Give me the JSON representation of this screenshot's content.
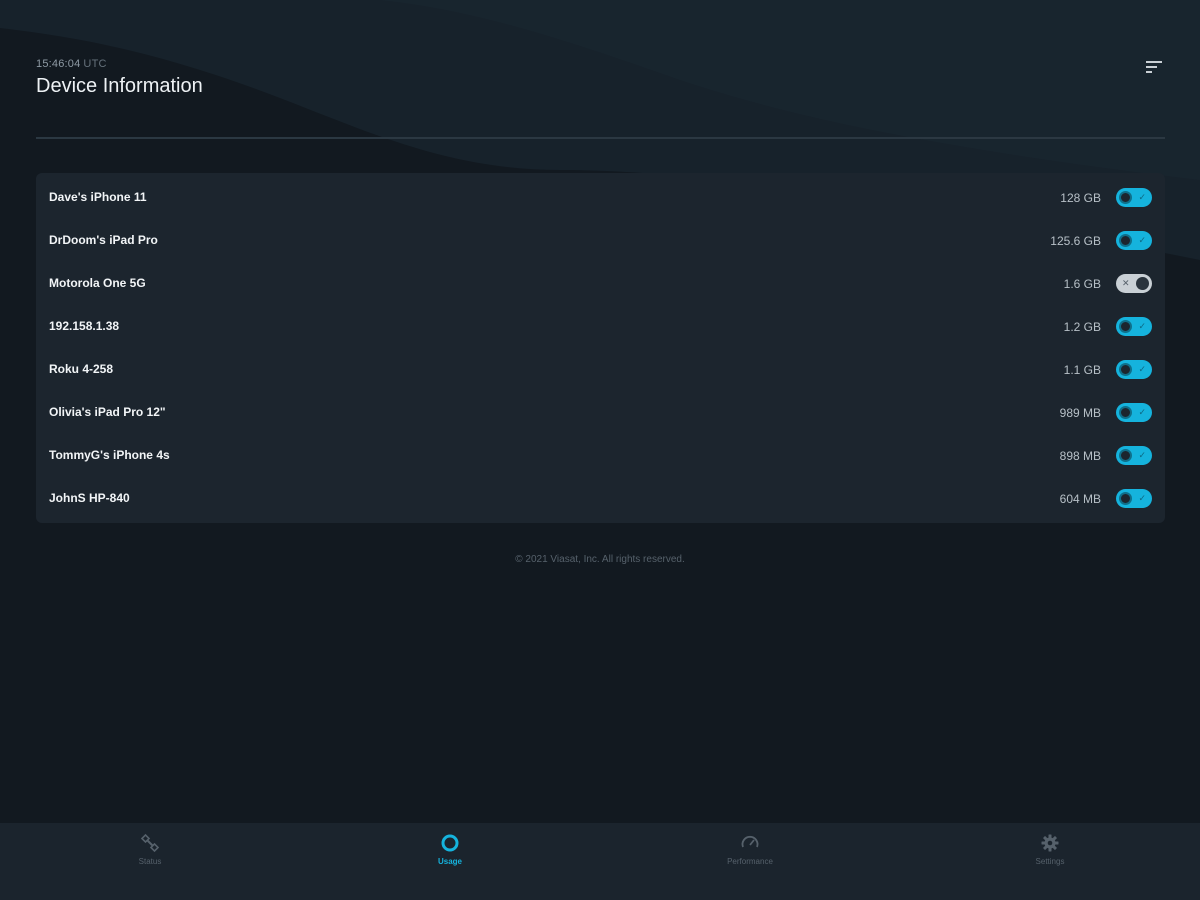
{
  "header": {
    "time": "15:46:04",
    "timezone": "UTC",
    "title": "Device Information",
    "filter_icon": "filter-lines-icon"
  },
  "devices": [
    {
      "name": "Dave's iPhone 11",
      "usage": "128 GB",
      "enabled": true
    },
    {
      "name": "DrDoom's iPad Pro",
      "usage": "125.6 GB",
      "enabled": true
    },
    {
      "name": "Motorola One 5G",
      "usage": "1.6 GB",
      "enabled": false
    },
    {
      "name": "192.158.1.38",
      "usage": "1.2 GB",
      "enabled": true
    },
    {
      "name": "Roku 4-258",
      "usage": "1.1 GB",
      "enabled": true
    },
    {
      "name": "Olivia's iPad Pro 12\"",
      "usage": "989 MB",
      "enabled": true
    },
    {
      "name": "TommyG's iPhone 4s",
      "usage": "898 MB",
      "enabled": true
    },
    {
      "name": "JohnS HP-840",
      "usage": "604 MB",
      "enabled": true
    }
  ],
  "footer": {
    "copyright": "© 2021 Viasat, Inc. All rights reserved."
  },
  "nav": [
    {
      "label": "Status",
      "icon": "satellite-icon",
      "active": false
    },
    {
      "label": "Usage",
      "icon": "usage-ring-icon",
      "active": true
    },
    {
      "label": "Performance",
      "icon": "speedometer-icon",
      "active": false
    },
    {
      "label": "Settings",
      "icon": "gear-icon",
      "active": false
    }
  ],
  "colors": {
    "background": "#121920",
    "card": "#1c252e",
    "accent": "#15b3dd",
    "toggle_off": "#c9d0d5",
    "nav_bar": "#1b242d"
  }
}
